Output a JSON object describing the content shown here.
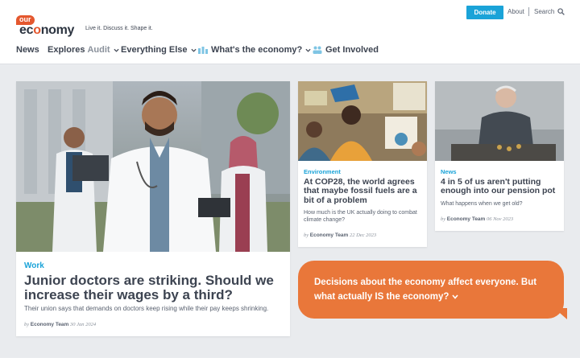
{
  "header": {
    "donate_label": "Donate",
    "about_label": "About",
    "search_label": "Search",
    "logo_our": "our",
    "logo_economy_pre": "ec",
    "logo_economy_o": "o",
    "logo_economy_post": "nomy",
    "tagline": "Live it. Discuss it. Shape it."
  },
  "nav": {
    "news": "News",
    "explores": "Explores",
    "audit": "Audit",
    "everything_else": "Everything Else",
    "whats_economy": "What's the economy?",
    "get_involved": "Get Involved"
  },
  "articles": [
    {
      "category": "Work",
      "title": "Junior doctors are striking. Should we increase their wages by a third?",
      "summary": "Their union says that demands on doctors keep rising while their pay keeps shrinking.",
      "by": "by",
      "author": "Economy Team",
      "date": "30 Jan 2024"
    },
    {
      "category": "Environment",
      "title": "At COP28, the world agrees that maybe fossil fuels are a bit of a problem",
      "summary": "How much is the UK actually doing to combat climate change?",
      "by": "by",
      "author": "Economy Team",
      "date": "22 Dec 2023"
    },
    {
      "category": "News",
      "title": "4 in 5 of us aren't putting enough into our pension pot",
      "summary": "What happens when we get old?",
      "by": "by",
      "author": "Economy Team",
      "date": "06 Nov 2023"
    }
  ],
  "callout": {
    "text": "Decisions about the economy affect everyone. But what actually IS the economy?"
  },
  "colors": {
    "accent_blue": "#1aa3d8",
    "brand_orange": "#e9773a",
    "logo_red": "#e4572e"
  }
}
